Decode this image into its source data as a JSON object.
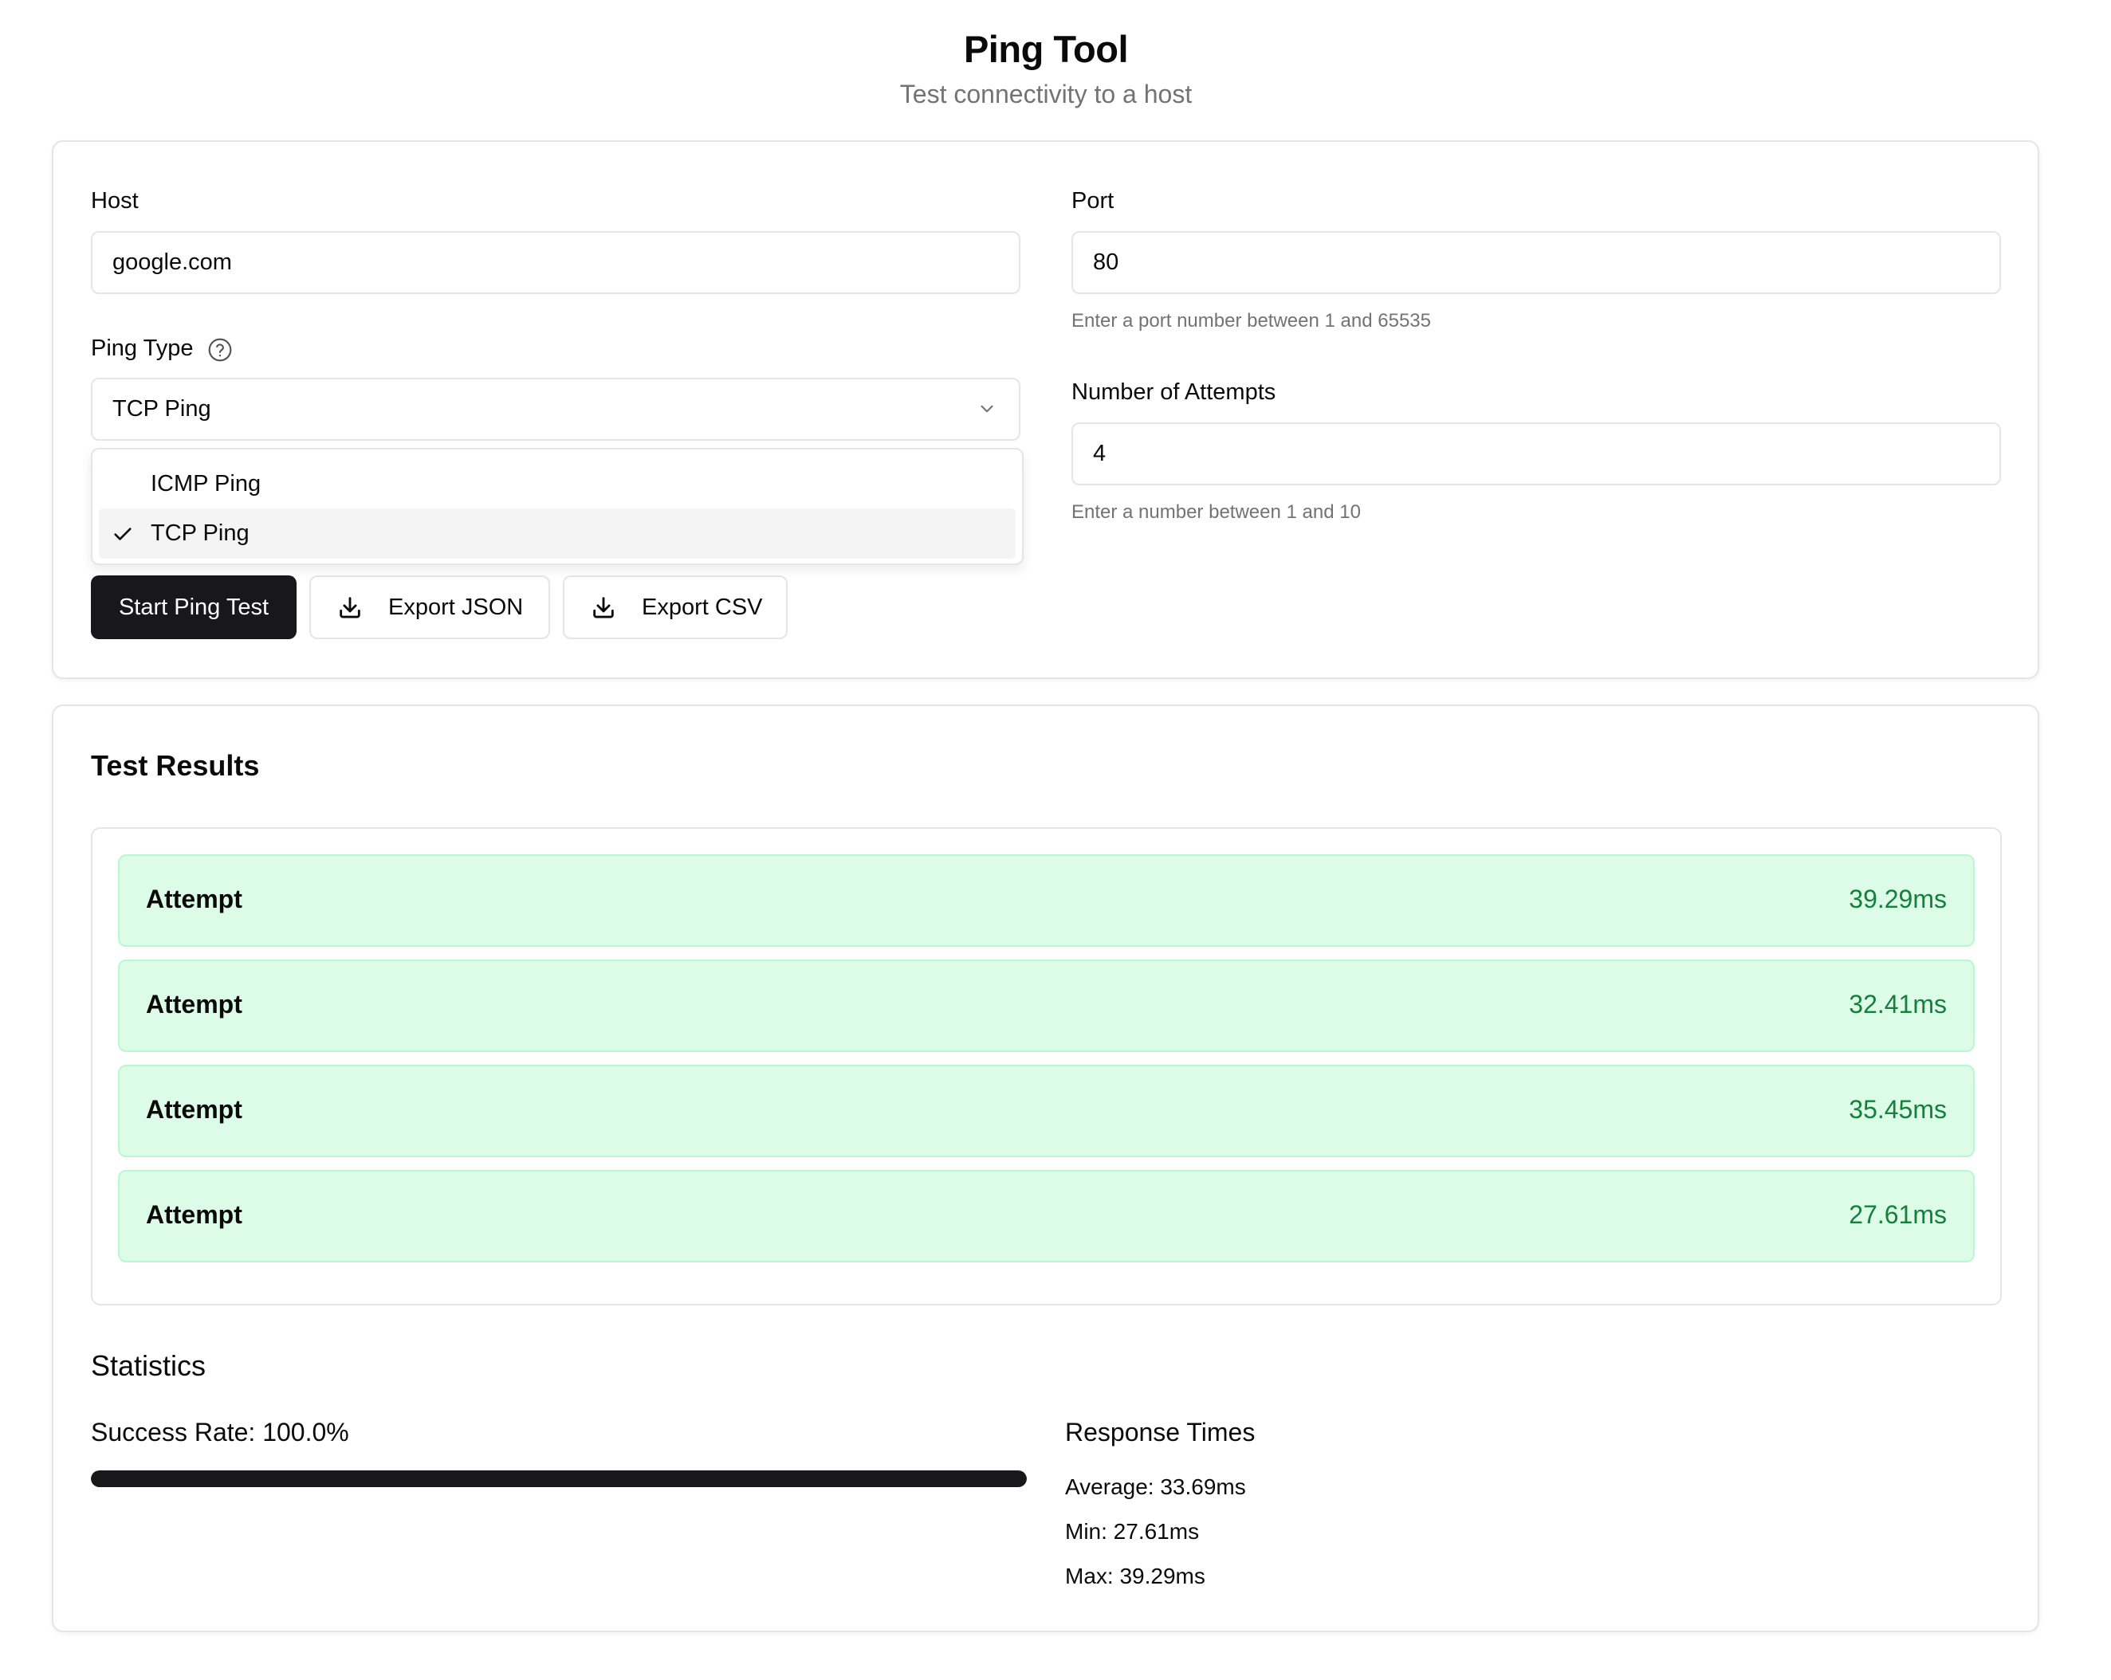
{
  "header": {
    "title": "Ping Tool",
    "subtitle": "Test connectivity to a host"
  },
  "form": {
    "host": {
      "label": "Host",
      "value": "google.com"
    },
    "port": {
      "label": "Port",
      "value": "80",
      "hint": "Enter a port number between 1 and 65535"
    },
    "ping_type": {
      "label": "Ping Type",
      "help_icon": "help-circle-icon",
      "selected": "TCP Ping",
      "options": [
        {
          "label": "ICMP Ping",
          "selected": false
        },
        {
          "label": "TCP Ping",
          "selected": true
        }
      ]
    },
    "attempts": {
      "label": "Number of Attempts",
      "value": "4",
      "hint": "Enter a number between 1 and 10"
    }
  },
  "actions": {
    "start_label": "Start Ping Test",
    "export_json_label": "Export JSON",
    "export_csv_label": "Export CSV",
    "download_icon": "download-icon"
  },
  "results": {
    "title": "Test Results",
    "attempts": [
      {
        "label": "Attempt",
        "value": "39.29ms"
      },
      {
        "label": "Attempt",
        "value": "32.41ms"
      },
      {
        "label": "Attempt",
        "value": "35.45ms"
      },
      {
        "label": "Attempt",
        "value": "27.61ms"
      }
    ]
  },
  "statistics": {
    "title": "Statistics",
    "success_rate_label": "Success Rate: 100.0%",
    "success_rate_fraction": 1.0,
    "response_times": {
      "title": "Response Times",
      "average": "Average: 33.69ms",
      "min": "Min: 27.61ms",
      "max": "Max: 39.29ms"
    }
  },
  "colors": {
    "primary": "#18181b",
    "success_bg": "#dcfce7",
    "success_border": "#bbf7d0",
    "success_text": "#15803d",
    "muted_text": "#737373",
    "border": "#e5e5e5"
  }
}
